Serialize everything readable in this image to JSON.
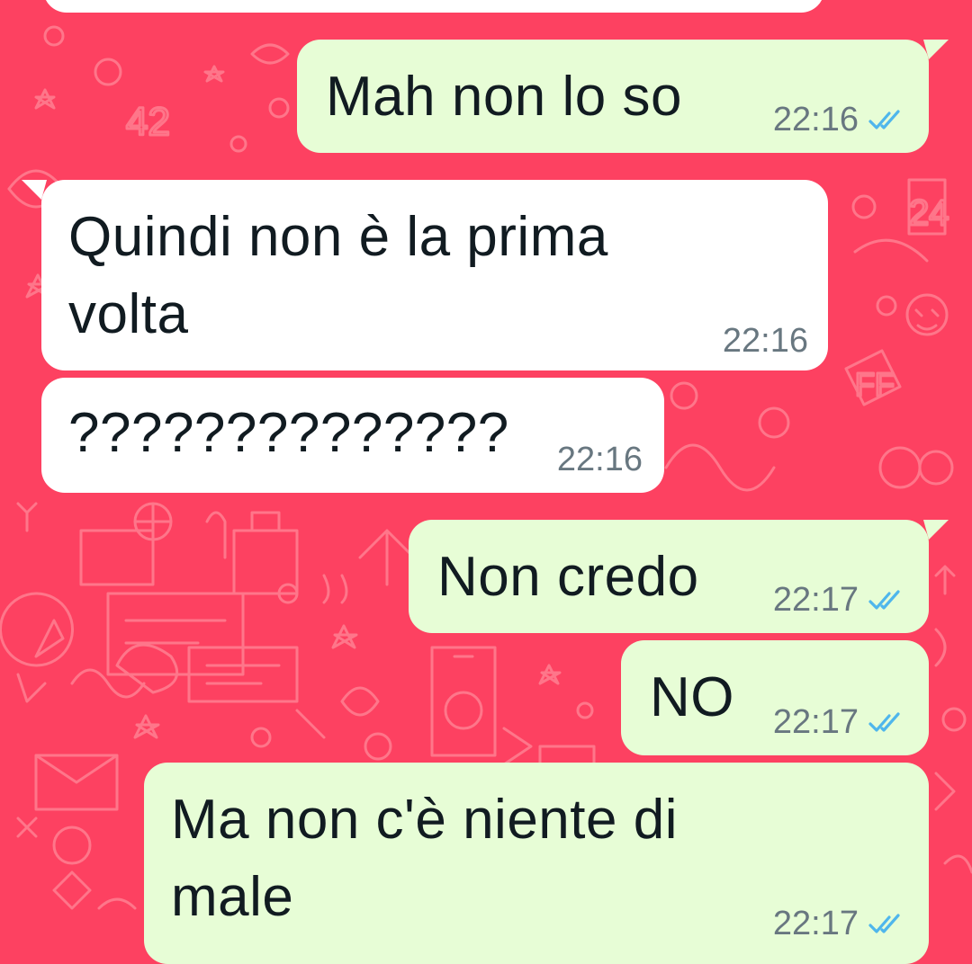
{
  "chat": {
    "messages": [
      {
        "text": "",
        "time": ""
      },
      {
        "text": "Mah non lo so",
        "time": "22:16",
        "read": true
      },
      {
        "text_line1": "Quindi non è la prima",
        "text_line2": "volta",
        "time": "22:16"
      },
      {
        "text": "??????????????",
        "time": "22:16"
      },
      {
        "text": "Non credo",
        "time": "22:17",
        "read": true
      },
      {
        "text": "NO",
        "time": "22:17",
        "read": true
      },
      {
        "text_line1": "Ma non c'è niente di",
        "text_line2": "male",
        "time": "22:17",
        "read": true
      }
    ]
  },
  "theme": {
    "wallpaper": "#fd4161",
    "incoming_bubble": "#ffffff",
    "outgoing_bubble": "#e7fdd6",
    "read_ticks": "#4fb6ec",
    "timestamp": "#687780"
  },
  "icons": {
    "read_receipt": "double-check-icon",
    "wallpaper": "whatsapp-doodle-pattern"
  }
}
